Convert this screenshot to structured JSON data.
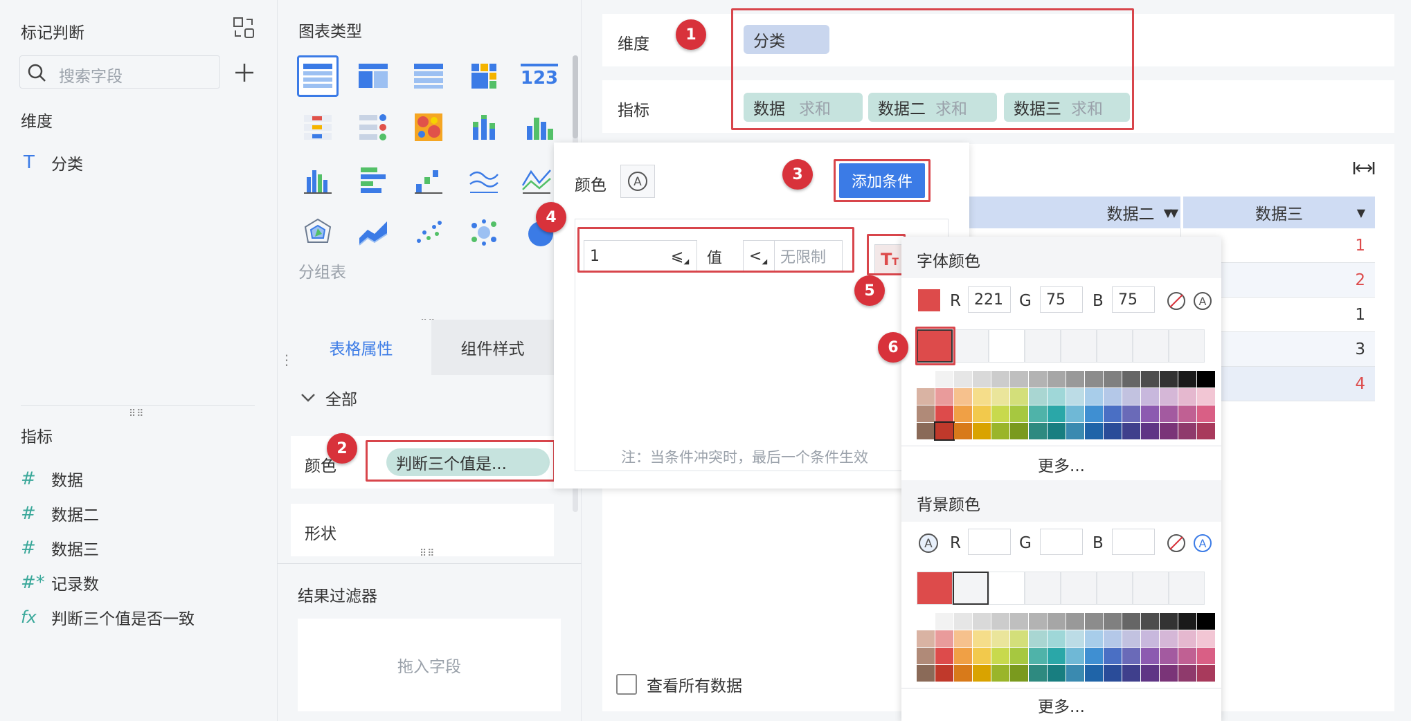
{
  "left": {
    "title": "标记判断",
    "search_placeholder": "搜索字段",
    "dim_header": "维度",
    "dimensions": [
      "分类"
    ],
    "metric_header": "指标",
    "metrics": [
      "数据",
      "数据二",
      "数据三",
      "记录数",
      "判断三个值是否一致"
    ]
  },
  "mid": {
    "chart_type_title": "图表类型",
    "group_table_label": "分组表",
    "tab_table_props": "表格属性",
    "tab_component_style": "组件样式",
    "all_label": "全部",
    "color_label": "颜色",
    "color_field": "判断三个值是...",
    "shape_label": "形状",
    "filter_title": "结果过滤器",
    "filter_drop": "拖入字段",
    "icon_123": "123"
  },
  "main": {
    "dim_label": "维度",
    "dim_pill": "分类",
    "metric_label": "指标",
    "metric_pills": [
      {
        "name": "数据",
        "agg": "求和"
      },
      {
        "name": "数据二",
        "agg": "求和"
      },
      {
        "name": "数据三",
        "agg": "求和"
      }
    ],
    "table_headers": [
      "数据二",
      "数据三"
    ],
    "col3_values": [
      "1",
      "2",
      "1",
      "3",
      "4"
    ],
    "col3_colors": [
      "#dd4b4b",
      "#dd4b4b",
      "#333333",
      "#333333",
      "#dd4b4b"
    ],
    "view_all": "查看所有数据"
  },
  "popup": {
    "color_label": "颜色",
    "add_condition": "添加条件",
    "cond_value": "1",
    "cond_op1": "⩽",
    "cond_field": "值",
    "cond_op2": "<",
    "cond_limit": "无限制",
    "note": "注：当条件冲突时，最后一个条件生效"
  },
  "colorpanel": {
    "font_color_title": "字体颜色",
    "r_label": "R",
    "g_label": "G",
    "b_label": "B",
    "font_r": "221",
    "font_g": "75",
    "font_b": "75",
    "more": "更多...",
    "bg_color_title": "背景颜色",
    "selected_color": "#dd4b4b"
  },
  "badges": [
    "1",
    "2",
    "3",
    "4",
    "5",
    "6"
  ],
  "colors": {
    "accent": "#3b7be6",
    "badge": "#d8323b",
    "highlight": "#dd4b4b"
  }
}
